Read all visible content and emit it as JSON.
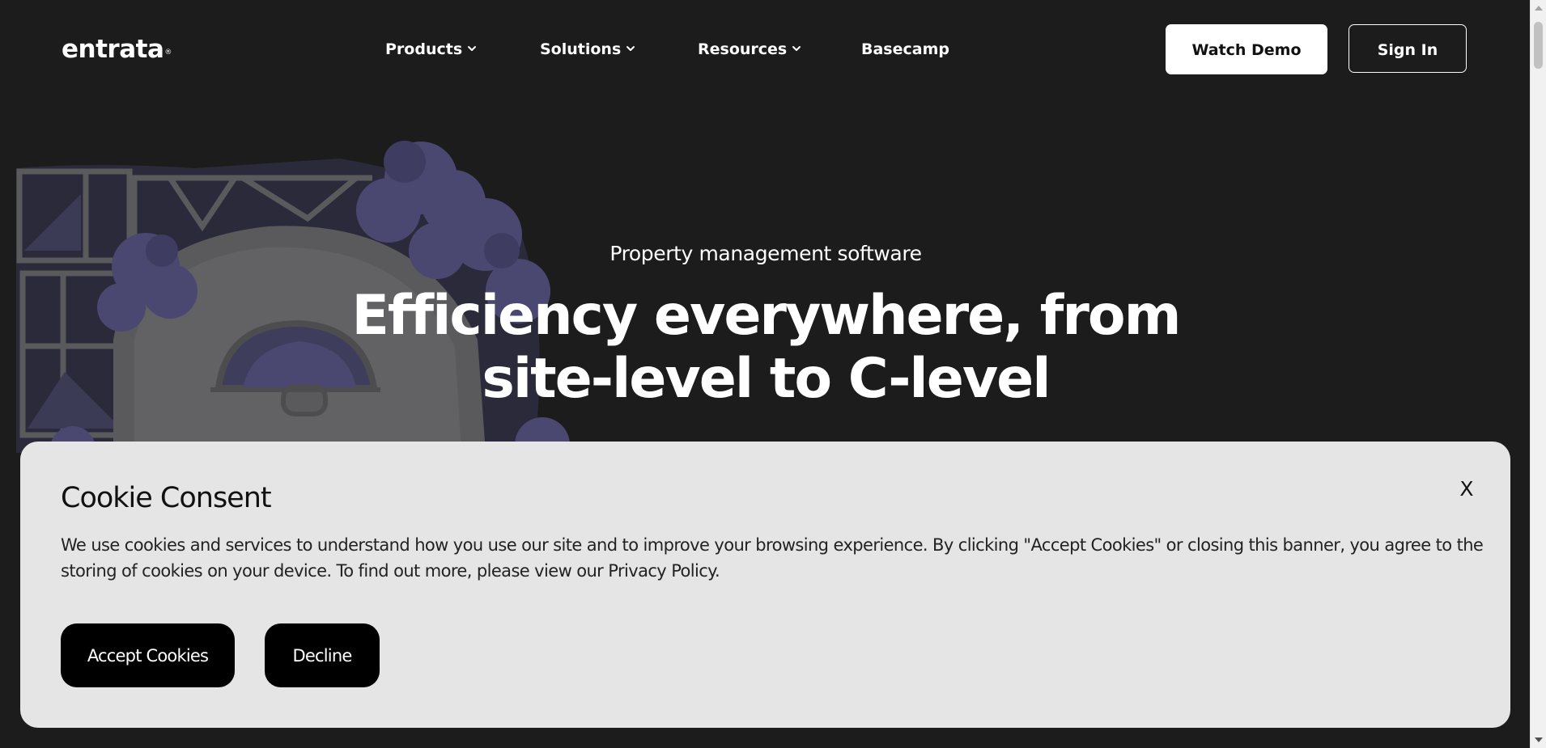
{
  "header": {
    "logo_text": "entrata",
    "logo_mark": "®",
    "nav": [
      {
        "label": "Products",
        "has_dropdown": true,
        "icon": "chevron-down-icon"
      },
      {
        "label": "Solutions",
        "has_dropdown": true,
        "icon": "chevron-down-icon"
      },
      {
        "label": "Resources",
        "has_dropdown": true,
        "icon": "chevron-down-icon"
      },
      {
        "label": "Basecamp",
        "has_dropdown": false
      }
    ],
    "watch_demo_label": "Watch Demo",
    "sign_in_label": "Sign In"
  },
  "hero": {
    "eyebrow": "Property management software",
    "title": "Efficiency everywhere, from site-level to C-level"
  },
  "cookie_banner": {
    "title": "Cookie Consent",
    "close_label": "X",
    "body": "We use cookies and services to understand how you use our site and to improve your browsing experience. By clicking \"Accept Cookies\" or closing this banner, you agree to the storing of cookies on your device. To find out more, please view our Privacy Policy.",
    "accept_label": "Accept Cookies",
    "decline_label": "Decline"
  },
  "colors": {
    "page_background": "#1c1c1d",
    "banner_background": "#e5e5e5",
    "illustration_purple": "#4a4870",
    "illustration_gray": "#5a5a5c"
  }
}
